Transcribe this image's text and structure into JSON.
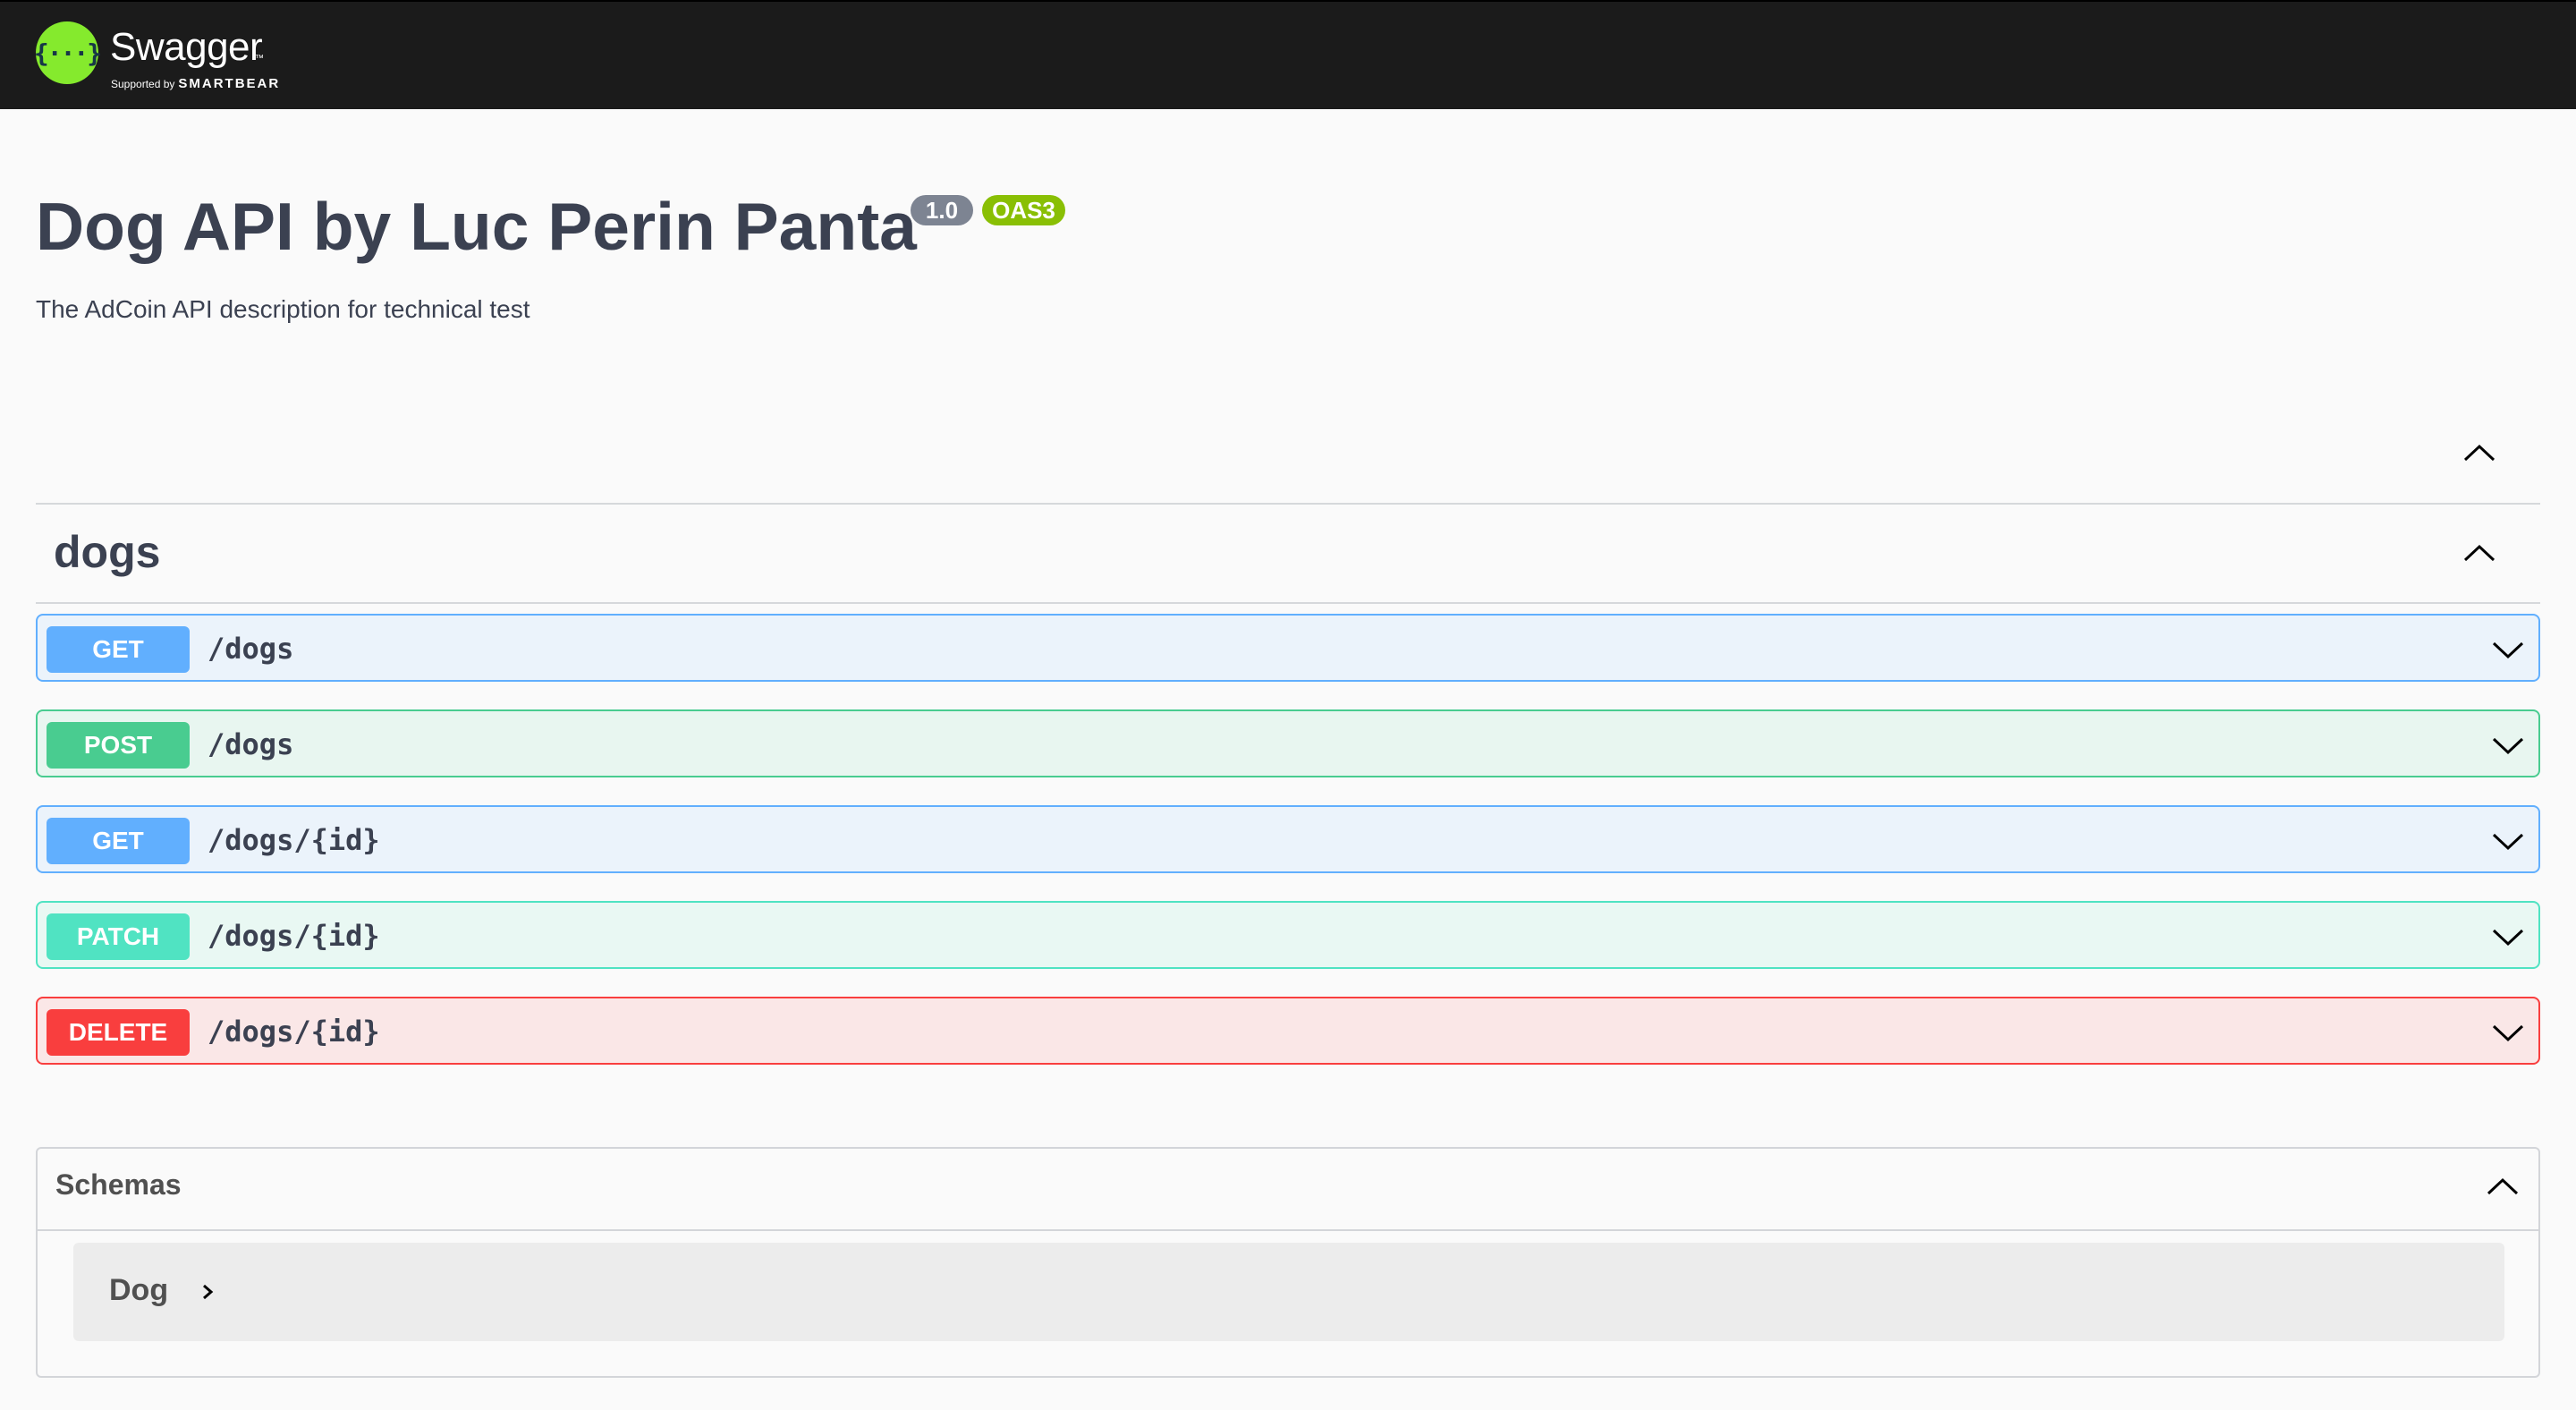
{
  "topbar": {
    "logo_glyph": "{···}",
    "brand_name": "Swagger",
    "brand_tm": "™",
    "supported_by": "Supported by",
    "smartbear": "SMARTBEAR"
  },
  "info": {
    "title": "Dog API by Luc Perin Panta",
    "version": "1.0",
    "oas": "OAS3",
    "description": "The AdCoin API description for technical test"
  },
  "tag": {
    "name": "dogs"
  },
  "operations": [
    {
      "method": "GET",
      "path": "/dogs"
    },
    {
      "method": "POST",
      "path": "/dogs"
    },
    {
      "method": "GET",
      "path": "/dogs/{id}"
    },
    {
      "method": "PATCH",
      "path": "/dogs/{id}"
    },
    {
      "method": "DELETE",
      "path": "/dogs/{id}"
    }
  ],
  "schemas": {
    "title": "Schemas",
    "models": [
      {
        "name": "Dog"
      }
    ]
  },
  "colors": {
    "get": "#61affe",
    "post": "#49cc90",
    "patch": "#50e3c2",
    "delete": "#f93e3e",
    "logo": "#85ea2d"
  }
}
